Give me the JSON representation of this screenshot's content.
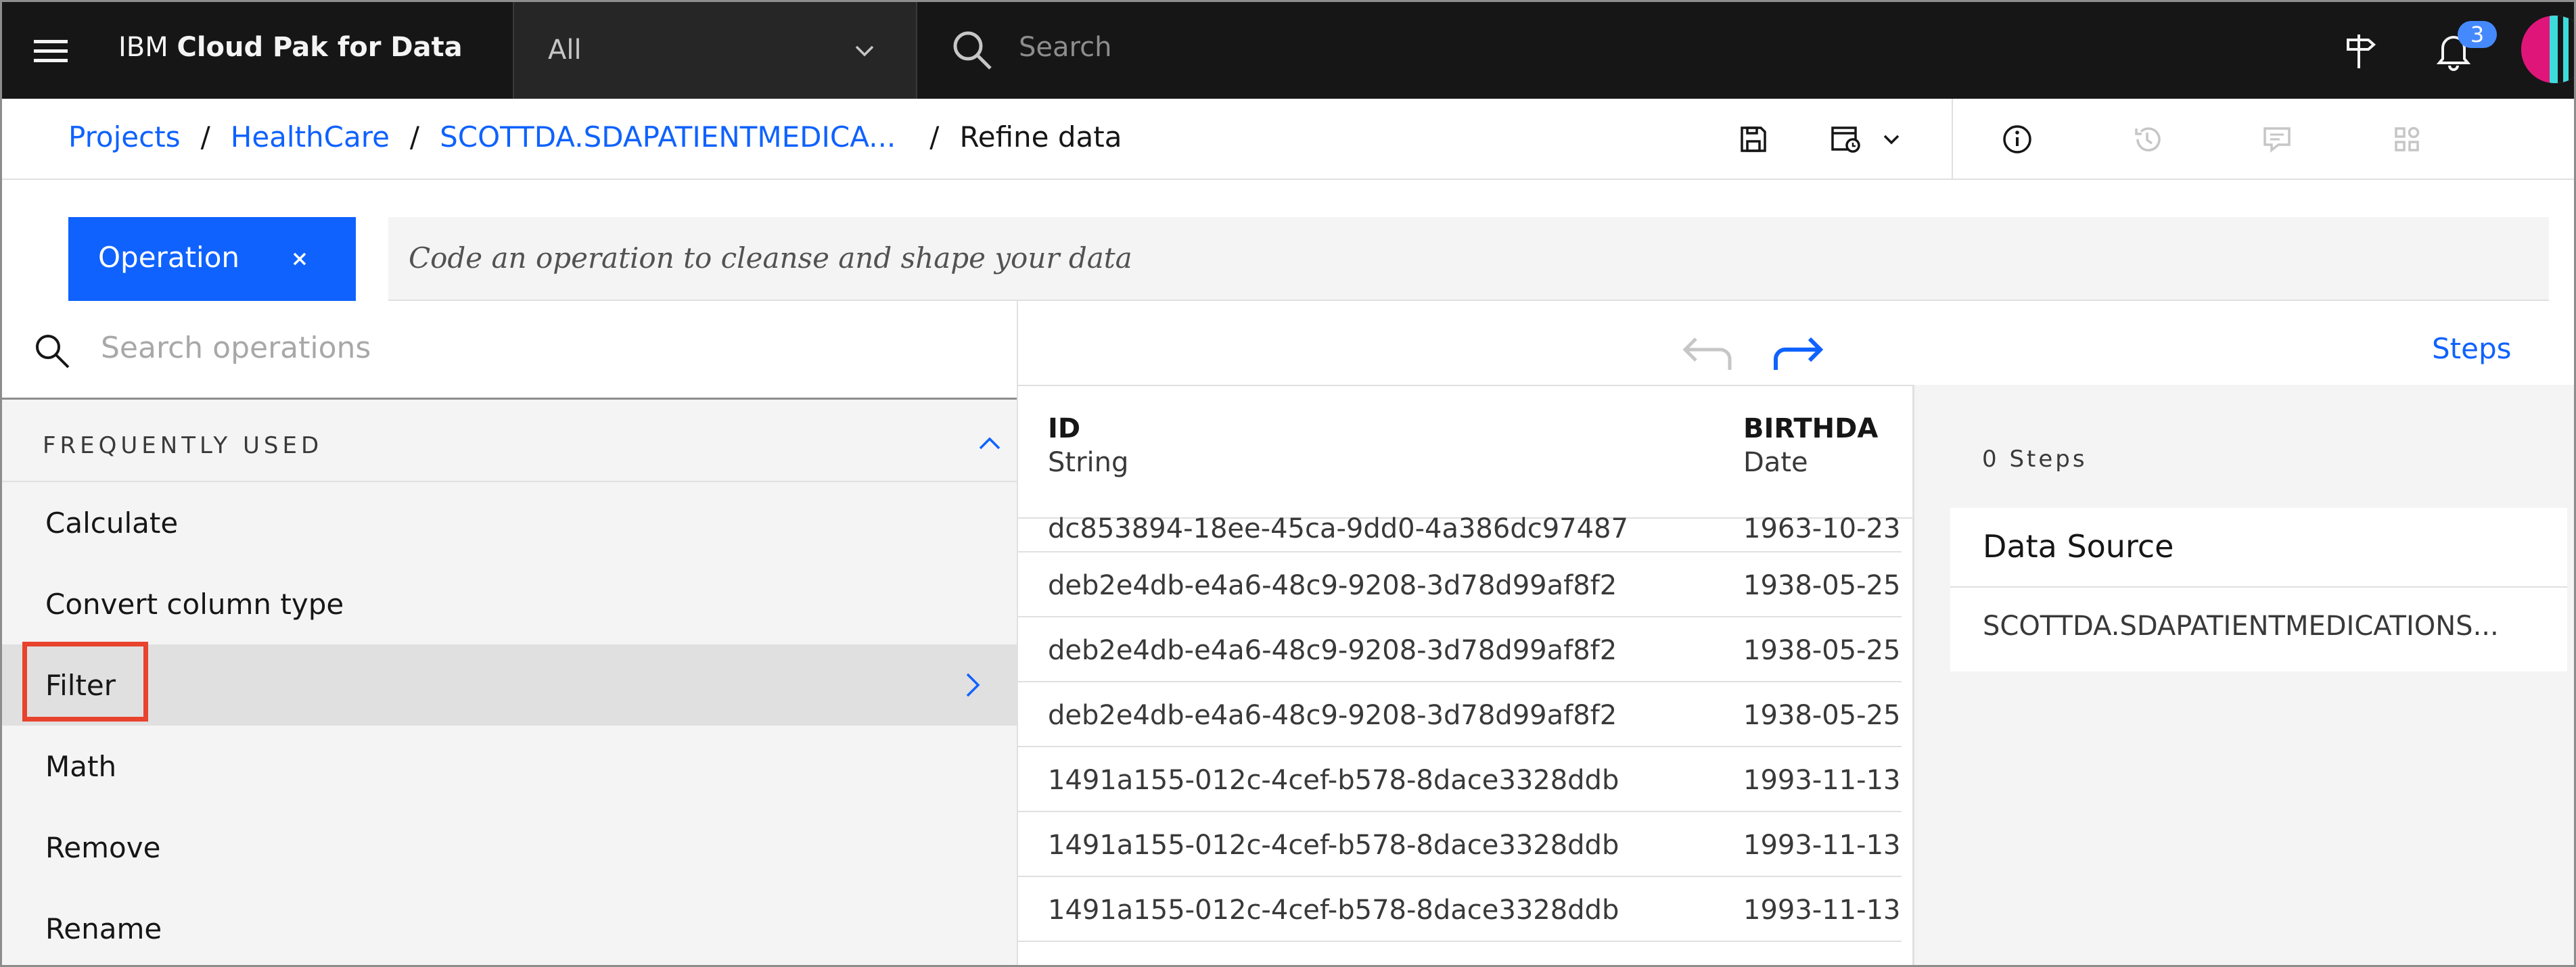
{
  "header": {
    "brand_prefix": "IBM",
    "brand_name": "Cloud Pak for Data",
    "scope_value": "All",
    "search_placeholder": "Search",
    "notifications_count": "3"
  },
  "breadcrumb": {
    "items": [
      "Projects",
      "HealthCare",
      "SCOTTDA.SDAPATIENTMEDICA..."
    ],
    "current": "Refine data",
    "separator": "/"
  },
  "operation": {
    "tag_label": "Operation",
    "code_placeholder": "Code an operation to cleanse and shape your data"
  },
  "operations_panel": {
    "search_placeholder": "Search operations",
    "section_title": "FREQUENTLY USED",
    "items": [
      {
        "label": "Calculate"
      },
      {
        "label": "Convert column type"
      },
      {
        "label": "Filter",
        "selected": true
      },
      {
        "label": "Math"
      },
      {
        "label": "Remove"
      },
      {
        "label": "Rename"
      }
    ]
  },
  "grid": {
    "steps_link": "Steps",
    "columns": [
      {
        "name": "ID",
        "type": "String"
      },
      {
        "name": "BIRTHDA",
        "type": "Date"
      }
    ],
    "rows": [
      [
        "dc853894-18ee-45ca-9dd0-4a386dc97487",
        "1963-10-23"
      ],
      [
        "deb2e4db-e4a6-48c9-9208-3d78d99af8f2",
        "1938-05-25"
      ],
      [
        "deb2e4db-e4a6-48c9-9208-3d78d99af8f2",
        "1938-05-25"
      ],
      [
        "deb2e4db-e4a6-48c9-9208-3d78d99af8f2",
        "1938-05-25"
      ],
      [
        "1491a155-012c-4cef-b578-8dace3328ddb",
        "1993-11-13"
      ],
      [
        "1491a155-012c-4cef-b578-8dace3328ddb",
        "1993-11-13"
      ],
      [
        "1491a155-012c-4cef-b578-8dace3328ddb",
        "1993-11-13"
      ]
    ]
  },
  "steps_panel": {
    "count_label": "0 Steps",
    "card_title": "Data Source",
    "source_name": "SCOTTDA.SDAPATIENTMEDICATIONS..."
  },
  "icons": {
    "menu": "hamburger-menu-icon",
    "scope": "chevron-down-icon",
    "search": "search-icon",
    "launch": "signpost-icon",
    "notifications": "bell-icon",
    "save": "save-icon",
    "schedule": "schedule-icon",
    "info": "info-icon",
    "history": "history-icon",
    "comments": "comment-icon",
    "apps": "apps-icon",
    "undo": "undo-icon",
    "redo": "redo-icon"
  },
  "colors": {
    "accent": "#0f62fe",
    "header_bg": "#161616",
    "highlight": "#e8432c",
    "badge": "#4589ff"
  }
}
